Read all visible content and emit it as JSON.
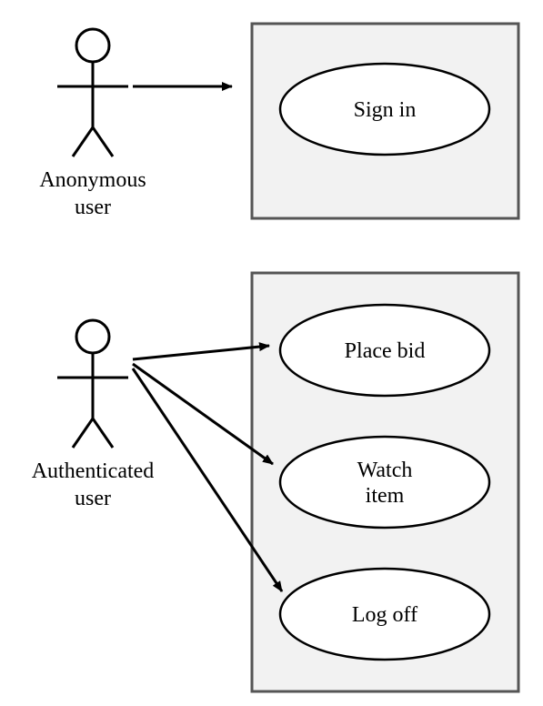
{
  "actors": [
    {
      "id": "anonymous",
      "label_line1": "Anonymous",
      "label_line2": "user"
    },
    {
      "id": "authenticated",
      "label_line1": "Authenticated",
      "label_line2": "user"
    }
  ],
  "usecases": [
    {
      "id": "signin",
      "label_line1": "Sign in",
      "label_line2": ""
    },
    {
      "id": "placebid",
      "label_line1": "Place bid",
      "label_line2": ""
    },
    {
      "id": "watchitem",
      "label_line1": "Watch",
      "label_line2": "item"
    },
    {
      "id": "logoff",
      "label_line1": "Log off",
      "label_line2": ""
    }
  ]
}
